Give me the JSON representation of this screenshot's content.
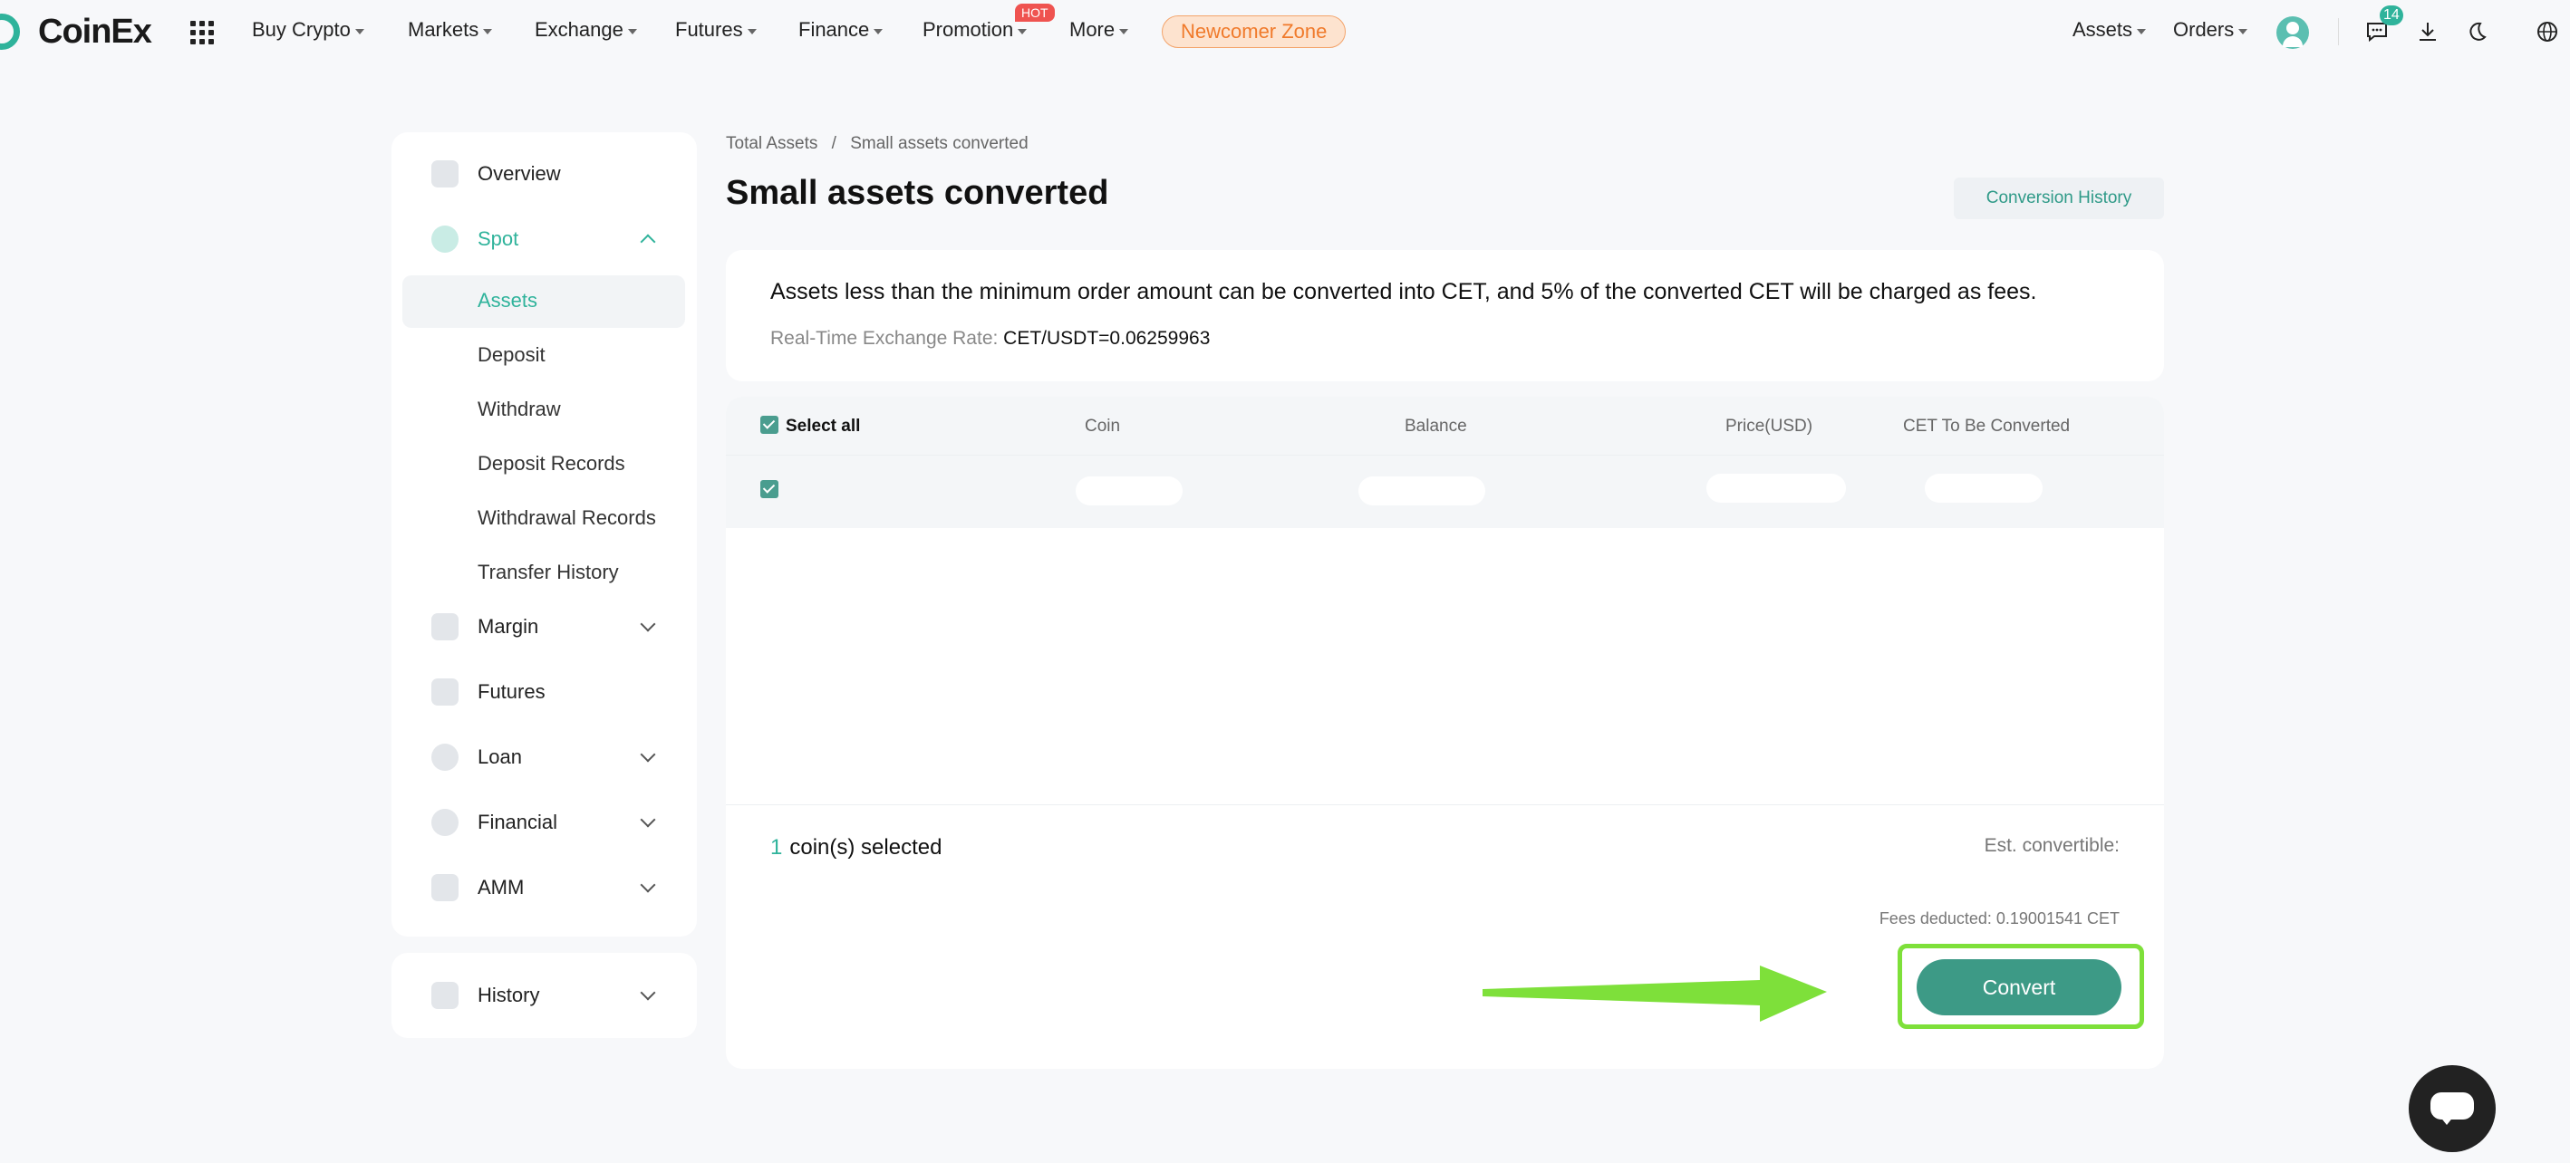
{
  "brand": {
    "name": "CoinEx",
    "accent": "#2fb39b",
    "highlight": "#7ee03a"
  },
  "nav": {
    "items": [
      "Buy Crypto",
      "Markets",
      "Exchange",
      "Futures",
      "Finance",
      "Promotion",
      "More"
    ],
    "hot_badge": "HOT",
    "newcomer": "Newcomer Zone",
    "right": {
      "assets": "Assets",
      "orders": "Orders",
      "messages_count": "14"
    }
  },
  "sidebar": {
    "overview": "Overview",
    "spot": "Spot",
    "spot_items": [
      "Assets",
      "Deposit",
      "Withdraw",
      "Deposit Records",
      "Withdrawal Records",
      "Transfer History"
    ],
    "margin": "Margin",
    "futures": "Futures",
    "loan": "Loan",
    "financial": "Financial",
    "amm": "AMM",
    "history": "History"
  },
  "breadcrumb": {
    "root": "Total Assets",
    "sep": "/",
    "current": "Small assets converted"
  },
  "page": {
    "title": "Small assets converted",
    "history_button": "Conversion History",
    "info": "Assets less than the minimum order amount can be converted into CET, and 5% of the converted CET will be charged as fees.",
    "rate_label": "Real-Time Exchange Rate",
    "rate_value": "CET/USDT=0.06259963"
  },
  "table": {
    "select_all": "Select all",
    "columns": [
      "Coin",
      "Balance",
      "Price(USD)",
      "CET To Be Converted"
    ]
  },
  "summary": {
    "selected_count": "1",
    "selected_label": "coin(s) selected",
    "est_label": "Est. convertible:",
    "fees": "Fees deducted: 0.19001541 CET",
    "convert_button": "Convert"
  }
}
